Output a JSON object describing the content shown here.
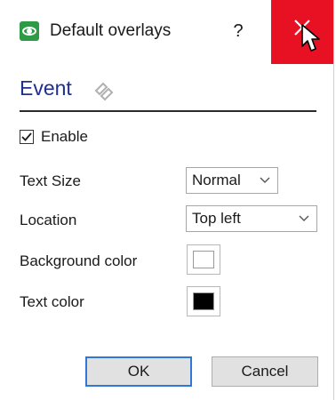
{
  "window": {
    "title": "Default overlays",
    "help_label": "?"
  },
  "icons": {
    "app": "eye-icon",
    "close": "close-icon",
    "section": "link-icon",
    "cursor": "mouse-pointer-icon",
    "caret": "chevron-down-icon"
  },
  "colors": {
    "close_bg": "#e81123",
    "section_title": "#1f2f8f",
    "app_icon": "#2f9a46",
    "ok_border": "#2f78d8",
    "background_color_value": "#ffffff",
    "text_color_value": "#000000"
  },
  "section": {
    "title": "Event"
  },
  "enable": {
    "label": "Enable",
    "checked": true
  },
  "fields": {
    "text_size": {
      "label": "Text Size",
      "value": "Normal"
    },
    "location": {
      "label": "Location",
      "value": "Top left"
    },
    "background_color": {
      "label": "Background color"
    },
    "text_color": {
      "label": "Text color"
    }
  },
  "buttons": {
    "ok": "OK",
    "cancel": "Cancel"
  }
}
